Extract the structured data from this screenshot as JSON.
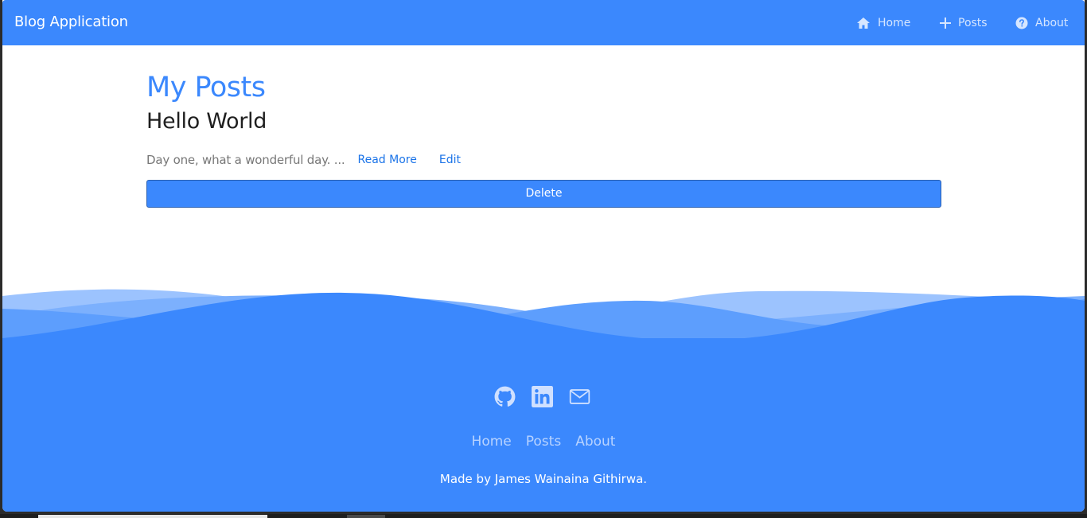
{
  "navbar": {
    "brand": "Blog Application",
    "items": [
      {
        "label": "Home",
        "icon": "home-icon"
      },
      {
        "label": "Posts",
        "icon": "plus-icon"
      },
      {
        "label": "About",
        "icon": "question-circle-icon"
      }
    ]
  },
  "main": {
    "page_title": "My Posts",
    "posts": [
      {
        "title": "Hello World",
        "excerpt": "Day one, what a wonderful day. ...",
        "read_more_label": "Read More",
        "edit_label": "Edit",
        "delete_label": "Delete"
      }
    ]
  },
  "footer": {
    "social_icons": [
      "github-icon",
      "linkedin-icon",
      "mail-icon"
    ],
    "links": [
      "Home",
      "Posts",
      "About"
    ],
    "credit": "Made by James Wainaina Githirwa."
  },
  "colors": {
    "primary": "#3b88fd",
    "nav_text": "#d6e6ff",
    "link": "#1a73e8",
    "excerpt": "#777777"
  }
}
